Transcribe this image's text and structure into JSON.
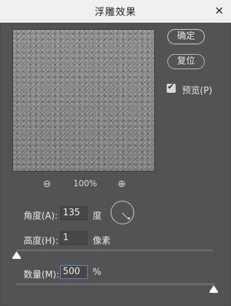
{
  "window": {
    "title": "浮雕效果",
    "close_label": "✕"
  },
  "buttons": {
    "ok": "确定",
    "reset": "复位"
  },
  "preview_checkbox": {
    "label": "预览(P)",
    "checked": true,
    "check_glyph": "✔"
  },
  "zoom": {
    "zoom_out_icon": "⊖",
    "value": "100%",
    "zoom_in_icon": "⊕"
  },
  "angle": {
    "label": "角度(A):",
    "value": "135",
    "unit": "度"
  },
  "height": {
    "label": "高度(H):",
    "value": "1",
    "unit": "像素"
  },
  "height_slider": {
    "value": 1
  },
  "amount": {
    "label": "数量(M):",
    "value": "500",
    "unit": "%"
  },
  "amount_slider": {
    "value_percent": 500,
    "max_percent": 500
  },
  "colors": {
    "accent": "#5b8ad9",
    "background": "#535353"
  }
}
